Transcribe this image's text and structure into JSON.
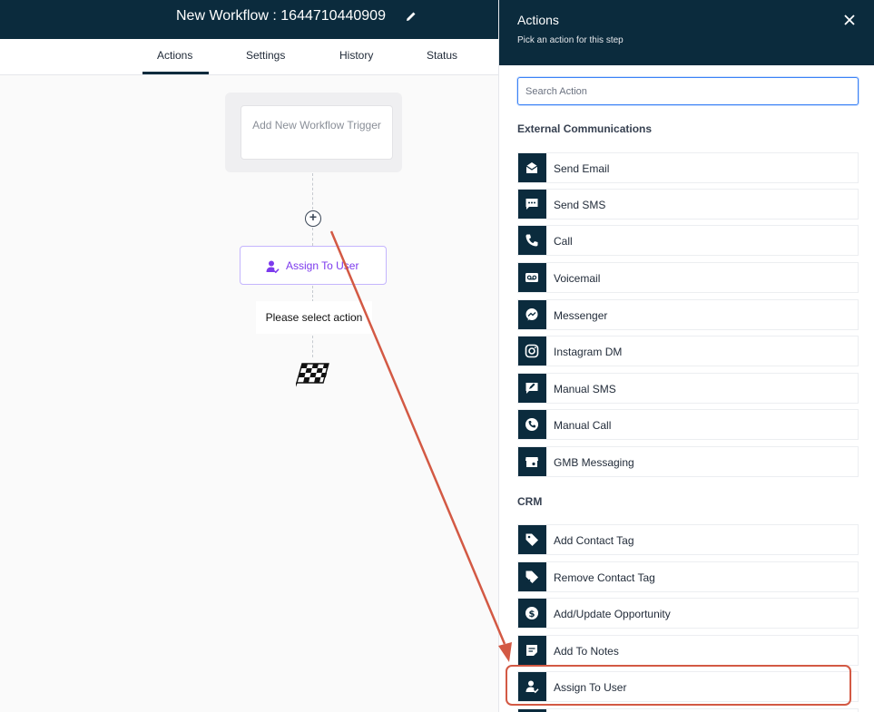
{
  "header": {
    "title": "New Workflow : 1644710440909",
    "edit_icon": "pencil-icon"
  },
  "tabs": [
    "Actions",
    "Settings",
    "History",
    "Status"
  ],
  "active_tab": "Actions",
  "canvas": {
    "trigger_label": "Add New Workflow Trigger",
    "add_icon": "plus-circle-icon",
    "node_label": "Assign To User",
    "node_icon": "user-check-icon",
    "select_prompt": "Please select action",
    "end_icon": "finish-flag-icon"
  },
  "panel": {
    "title": "Actions",
    "subtitle": "Pick an action for this step",
    "close_icon": "close-icon",
    "search_placeholder": "Search Action",
    "sections": [
      {
        "title": "External Communications",
        "items": [
          {
            "label": "Send Email",
            "icon": "email-icon"
          },
          {
            "label": "Send SMS",
            "icon": "sms-icon"
          },
          {
            "label": "Call",
            "icon": "phone-icon"
          },
          {
            "label": "Voicemail",
            "icon": "voicemail-icon"
          },
          {
            "label": "Messenger",
            "icon": "messenger-icon"
          },
          {
            "label": "Instagram DM",
            "icon": "instagram-icon"
          },
          {
            "label": "Manual SMS",
            "icon": "manual-sms-icon"
          },
          {
            "label": "Manual Call",
            "icon": "manual-call-icon"
          },
          {
            "label": "GMB Messaging",
            "icon": "gmb-icon"
          }
        ]
      },
      {
        "title": "CRM",
        "items": [
          {
            "label": "Add Contact Tag",
            "icon": "tag-icon"
          },
          {
            "label": "Remove Contact Tag",
            "icon": "tag-remove-icon"
          },
          {
            "label": "Add/Update Opportunity",
            "icon": "dollar-icon"
          },
          {
            "label": "Add To Notes",
            "icon": "note-icon"
          },
          {
            "label": "Assign To User",
            "icon": "user-check-icon"
          }
        ]
      }
    ]
  },
  "colors": {
    "header_bg": "#0b2b3d",
    "node_accent": "#7c3aed",
    "annotation": "#d35944",
    "search_focus": "#3b82f6"
  }
}
